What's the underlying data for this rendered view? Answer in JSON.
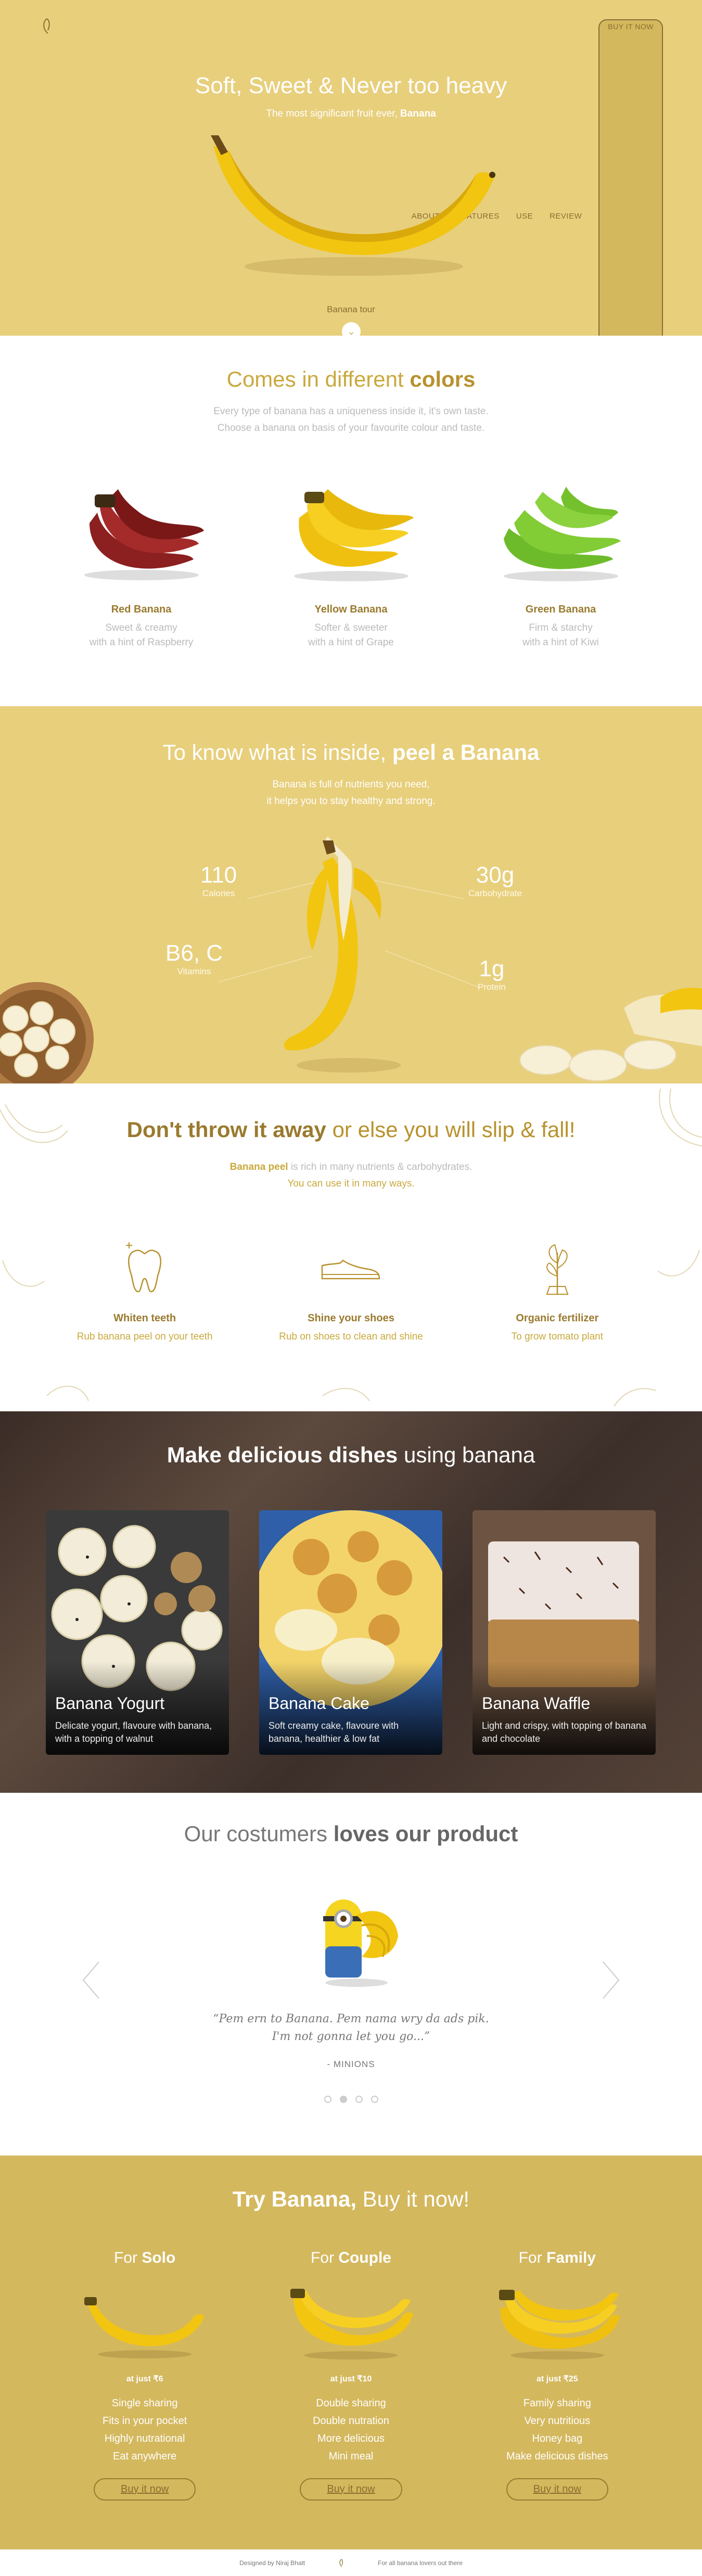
{
  "nav": {
    "items": [
      "ABOUT",
      "FEATURES",
      "USE",
      "REVIEW"
    ],
    "buy_label": "BUY IT NOW"
  },
  "hero": {
    "title": "Soft, Sweet & Never too heavy",
    "subtitle_pre": "The most significant fruit ever,",
    "subtitle_bold": "Banana",
    "tour_label": "Banana tour"
  },
  "colors": {
    "title_pre": "Comes in different",
    "title_bold": "colors",
    "sub1": "Every type of banana has a uniqueness inside it, it's own taste.",
    "sub2": "Choose a banana on basis of your favourite colour and taste.",
    "items": [
      {
        "name": "Red Banana",
        "line1": "Sweet & creamy",
        "line2": "with a hint of Raspberry"
      },
      {
        "name": "Yellow Banana",
        "line1": "Softer & sweeter",
        "line2": "with a hint of Grape"
      },
      {
        "name": "Green Banana",
        "line1": "Firm & starchy",
        "line2": "with a hint of Kiwi"
      }
    ]
  },
  "peel": {
    "title_pre": "To know what is inside,",
    "title_bold": "peel a Banana",
    "sub1": "Banana is full of nutrients you need,",
    "sub2": "it helps you to stay healthy and strong.",
    "nutrients": [
      {
        "value": "110",
        "label": "Calories"
      },
      {
        "value": "30g",
        "label": "Carbohydrate"
      },
      {
        "value": "B6, C",
        "label": "Vitamins"
      },
      {
        "value": "1g",
        "label": "Protein"
      }
    ]
  },
  "throw": {
    "title_bold": "Don't throw it away",
    "title_rest": "or else you will slip & fall!",
    "sub_bold": "Banana peel",
    "sub_rest": "is rich in many nutrients & carbohydrates.",
    "sub2": "You can use it in many ways.",
    "uses": [
      {
        "name": "Whiten teeth",
        "desc": "Rub banana peel on your teeth"
      },
      {
        "name": "Shine your shoes",
        "desc": "Rub on shoes to clean and shine"
      },
      {
        "name": "Organic fertilizer",
        "desc": "To grow tomato plant"
      }
    ]
  },
  "dishes": {
    "title_bold": "Make delicious dishes",
    "title_rest": "using banana",
    "cards": [
      {
        "name": "Banana Yogurt",
        "desc": "Delicate yogurt, flavoure with banana, with a topping of walnut"
      },
      {
        "name": "Banana Cake",
        "desc": "Soft creamy cake, flavoure with banana, healthier & low fat"
      },
      {
        "name": "Banana Waffle",
        "desc": "Light and crispy, with topping of banana and chocolate"
      }
    ]
  },
  "review": {
    "title_pre": "Our costumers",
    "title_bold": "loves our product",
    "quote1": "“Pem ern to Banana. Pem nama wry da ads pik.",
    "quote2": "I'm not gonna let you go...”",
    "author": "- MINIONS"
  },
  "buy": {
    "title_bold": "Try Banana,",
    "title_rest": "Buy it now!",
    "plans": [
      {
        "for": "For",
        "who": "Solo",
        "price": "at just ₹6",
        "features": [
          "Single sharing",
          "Fits in your pocket",
          "Highly nutrational",
          "Eat anywhere"
        ],
        "button": "Buy it now"
      },
      {
        "for": "For",
        "who": "Couple",
        "price": "at just ₹10",
        "features": [
          "Double sharing",
          "Double nutration",
          "More delicious",
          "Mini meal"
        ],
        "button": "Buy it now"
      },
      {
        "for": "For",
        "who": "Family",
        "price": "at just ₹25",
        "features": [
          "Family sharing",
          "Very nutritious",
          "Honey bag",
          "Make delicious dishes"
        ],
        "button": "Buy it now"
      }
    ]
  },
  "footer": {
    "left": "Designed by Niraj Bhatt",
    "right": "For all banana lovers out there"
  }
}
